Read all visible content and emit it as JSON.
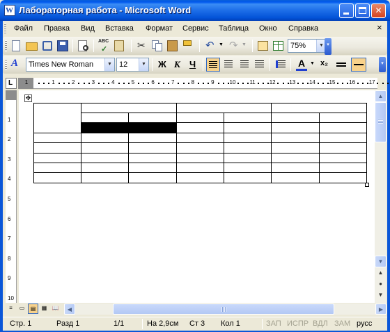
{
  "window": {
    "title": "Лабораторная работа - Microsoft Word",
    "app_icon_letter": "W"
  },
  "menu": {
    "items": [
      {
        "label": "Файл",
        "mnemonic": "Ф"
      },
      {
        "label": "Правка",
        "mnemonic": "П"
      },
      {
        "label": "Вид",
        "mnemonic": "В"
      },
      {
        "label": "Вставка",
        "mnemonic": "а"
      },
      {
        "label": "Формат",
        "mnemonic": "о"
      },
      {
        "label": "Сервис",
        "mnemonic": "С"
      },
      {
        "label": "Таблица",
        "mnemonic": "Т"
      },
      {
        "label": "Окно",
        "mnemonic": "О"
      },
      {
        "label": "Справка",
        "mnemonic": "С"
      }
    ],
    "close_glyph": "×"
  },
  "standard_toolbar": {
    "zoom": "75%"
  },
  "format_toolbar": {
    "style_glyph": "A",
    "font": "Times New Roman",
    "font_size": "12",
    "bold": "Ж",
    "italic": "К",
    "underline": "Ч",
    "font_color_glyph": "A",
    "subscript": "x₂",
    "font_color": "#1f3fd0"
  },
  "ruler": {
    "horizontal_labels": [
      "1",
      "1",
      "2",
      "3",
      "4",
      "5",
      "6",
      "7",
      "8",
      "9",
      "10",
      "11",
      "12",
      "13",
      "14",
      "15",
      "16",
      "17"
    ],
    "vertical_labels": [
      "1",
      "2",
      "3",
      "4",
      "5",
      "6",
      "7",
      "8",
      "9",
      "10"
    ],
    "tab_marker": "L"
  },
  "table": {
    "handle_glyph": "✥",
    "rows": 8,
    "columns": 7,
    "selected_cells": "row 3, columns 2-3"
  },
  "view_buttons": [
    "≡",
    "▭",
    "▤",
    "▦",
    "📖"
  ],
  "status": {
    "page": "Стр. 1",
    "section": "Разд 1",
    "pages": "1/1",
    "position": "На 2,9см",
    "line": "Ст 3",
    "column": "Кол 1",
    "modes": [
      "ЗАП",
      "ИСПР",
      "ВДЛ",
      "ЗАМ"
    ],
    "language": "русс"
  }
}
